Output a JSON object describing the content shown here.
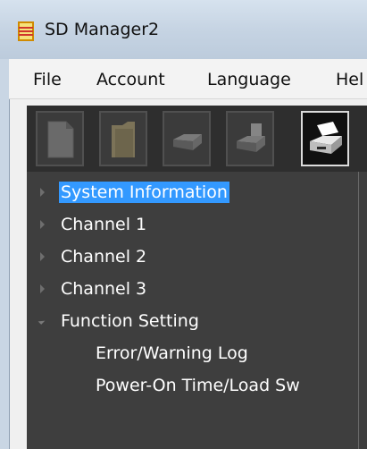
{
  "window": {
    "title": "SD Manager2"
  },
  "menu": [
    "File",
    "Account",
    "Language",
    "Hel"
  ],
  "toolbar": {
    "buttons": [
      {
        "name": "document-icon",
        "active": false
      },
      {
        "name": "folder-icon",
        "active": false
      },
      {
        "name": "device-icon",
        "active": false
      },
      {
        "name": "device-export-icon",
        "active": false
      },
      {
        "name": "printer-device-icon",
        "active": true
      }
    ]
  },
  "tree": {
    "items": [
      {
        "label": "System Information",
        "level": 0,
        "expander": "collapsed",
        "selected": true
      },
      {
        "label": "Channel 1",
        "level": 0,
        "expander": "collapsed",
        "selected": false
      },
      {
        "label": "Channel 2",
        "level": 0,
        "expander": "collapsed",
        "selected": false
      },
      {
        "label": "Channel 3",
        "level": 0,
        "expander": "collapsed",
        "selected": false
      },
      {
        "label": "Function Setting",
        "level": 0,
        "expander": "expanded",
        "selected": false
      },
      {
        "label": "Error/Warning Log",
        "level": 1,
        "expander": "none",
        "selected": false
      },
      {
        "label": "Power-On Time/Load Sw",
        "level": 1,
        "expander": "none",
        "selected": false
      }
    ]
  },
  "colors": {
    "selection": "#3399ff",
    "tree_background": "#3e3e3e",
    "toolbar_background": "#2e2e2e",
    "app_icon": "#e8c23a"
  }
}
